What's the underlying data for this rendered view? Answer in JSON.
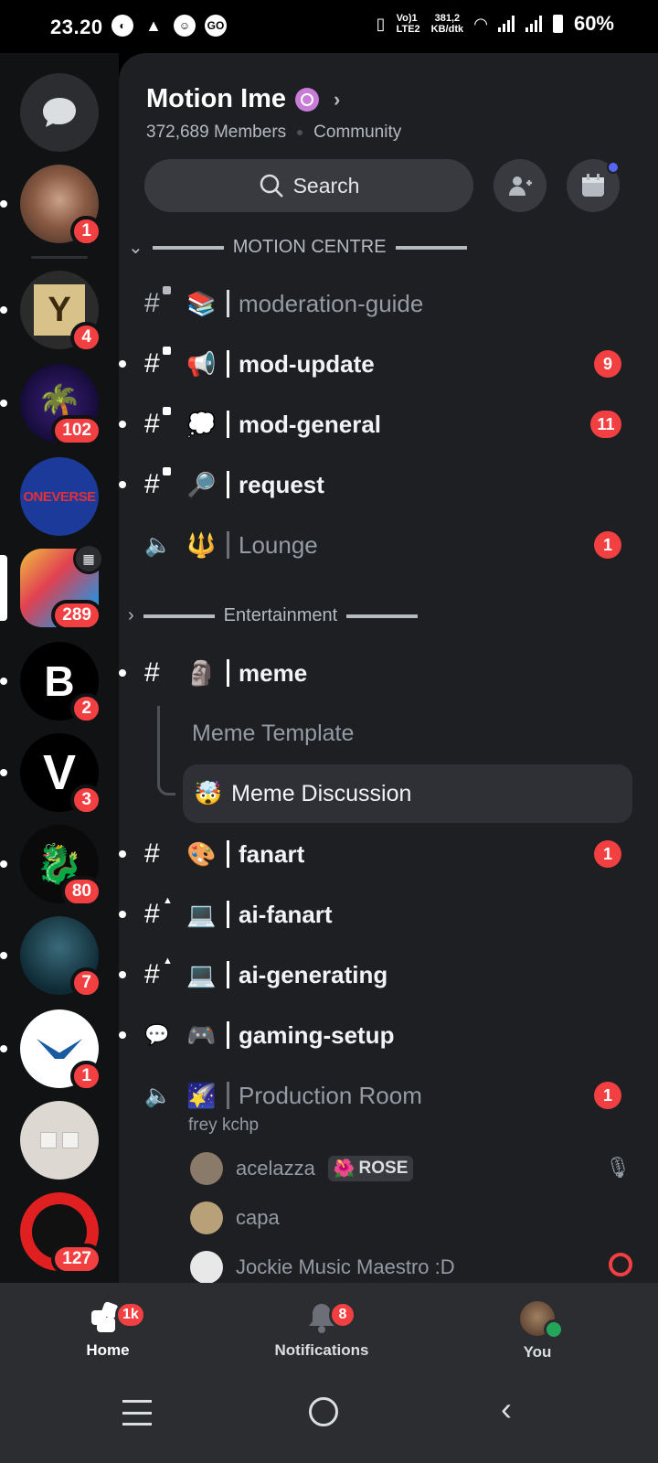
{
  "status": {
    "time": "23.20",
    "net_speed": "381,2",
    "net_unit": "KB/dtk",
    "lte_label": "LTE2",
    "vo_label": "Vo)1",
    "battery": "60%"
  },
  "rail": {
    "badges": [
      "1",
      "4",
      "102",
      "289",
      "2",
      "3",
      "80",
      "7",
      "1",
      "127"
    ],
    "oneverse_text": "ONEVERSE"
  },
  "server": {
    "name": "Motion Ime",
    "members": "372,689 Members",
    "type": "Community",
    "search_label": "Search"
  },
  "categories": {
    "motion": "MOTION CENTRE",
    "entertainment": "Entertainment"
  },
  "channels": [
    {
      "name": "moderation-guide",
      "emoji": "📚"
    },
    {
      "name": "mod-update",
      "emoji": "📢",
      "badge": "9"
    },
    {
      "name": "mod-general",
      "emoji": "💭",
      "badge": "11"
    },
    {
      "name": "request",
      "emoji": "🔎"
    },
    {
      "name": "Lounge",
      "emoji": "🔱",
      "badge": "1"
    },
    {
      "name": "meme",
      "emoji": "🗿"
    },
    {
      "name": "fanart",
      "emoji": "🎨",
      "badge": "1"
    },
    {
      "name": "ai-fanart",
      "emoji": "💻"
    },
    {
      "name": "ai-generating",
      "emoji": "💻"
    },
    {
      "name": "gaming-setup",
      "emoji": "🎮"
    },
    {
      "name": "Production Room",
      "emoji": "🌠",
      "badge": "1"
    }
  ],
  "threads": {
    "template": "Meme Template",
    "discussion": "Meme Discussion",
    "discussion_emoji": "🤯"
  },
  "voice": {
    "status": "frey kchp",
    "users": [
      {
        "name": "acelazza",
        "tag": "ROSE",
        "tag_emoji": "🌺"
      },
      {
        "name": "capa"
      },
      {
        "name": "Jockie Music Maestro :D"
      }
    ]
  },
  "nav": {
    "home": "Home",
    "home_badge": "1k",
    "notifications": "Notifications",
    "notif_badge": "8",
    "you": "You"
  },
  "colors": {
    "accent": "#5865f2",
    "badge": "#f23f42",
    "online": "#23a55a"
  }
}
